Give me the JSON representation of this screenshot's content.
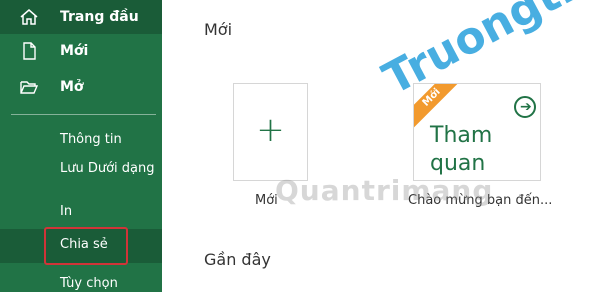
{
  "sidebar": {
    "home_label": "Trang đầu",
    "new_label": "Mới",
    "open_label": "Mở",
    "info_label": "Thông tin",
    "saveas_label": "Lưu Dưới dạng",
    "print_label": "In",
    "share_label": "Chia sẻ",
    "options_label": "Tùy chọn"
  },
  "main": {
    "new_heading": "Mới",
    "blank_caption": "Mới",
    "tour_badge": "Mới",
    "tour_title": "Tham quan",
    "tour_caption": "Chào mừng bạn đến...",
    "recent_heading": "Gần đây"
  },
  "watermark": {
    "text1": "Quantrimang",
    "text2": "Truongtin.top"
  },
  "colors": {
    "sidebar": "#217346",
    "active": "#1a5c38",
    "highlight_box": "#d13438",
    "badge": "#f29a2e"
  }
}
